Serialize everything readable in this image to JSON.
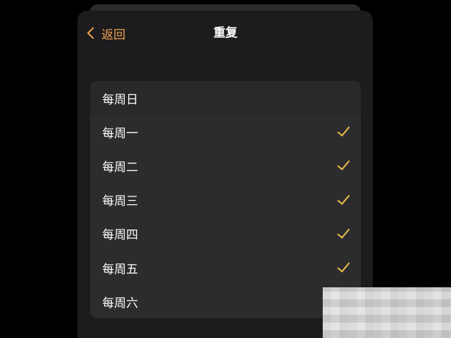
{
  "nav": {
    "back_label": "返回",
    "title": "重复"
  },
  "days": [
    {
      "label": "每周日",
      "checked": false
    },
    {
      "label": "每周一",
      "checked": true
    },
    {
      "label": "每周二",
      "checked": true
    },
    {
      "label": "每周三",
      "checked": true
    },
    {
      "label": "每周四",
      "checked": true
    },
    {
      "label": "每周五",
      "checked": true
    },
    {
      "label": "每周六",
      "checked": false
    }
  ],
  "colors": {
    "accent": "#f0a250",
    "checkmark": "#f0c04a",
    "background": "#1c1c1e",
    "list_background": "#2c2c2e"
  },
  "icons": {
    "back": "chevron-left-icon",
    "check": "checkmark-icon"
  }
}
